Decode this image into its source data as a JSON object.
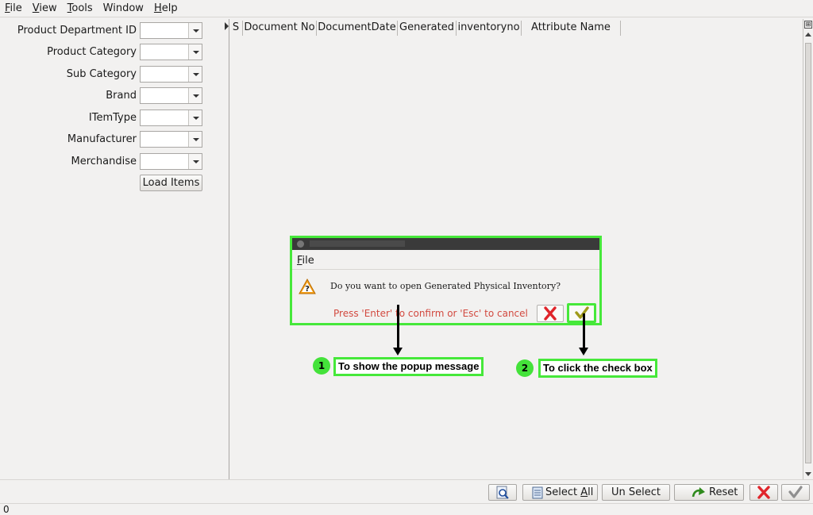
{
  "menu": [
    {
      "label": "File",
      "mnemonic": "F",
      "rest": "ile"
    },
    {
      "label": "View",
      "mnemonic": "V",
      "rest": "iew"
    },
    {
      "label": "Tools",
      "mnemonic": "T",
      "rest": "ools"
    },
    {
      "label": "Window",
      "mnemonic": "",
      "rest": "Window"
    },
    {
      "label": "Help",
      "mnemonic": "H",
      "rest": "elp"
    }
  ],
  "filters": [
    {
      "label": "Product Department ID",
      "value": ""
    },
    {
      "label": "Product Category",
      "value": ""
    },
    {
      "label": "Sub Category",
      "value": ""
    },
    {
      "label": "Brand",
      "value": ""
    },
    {
      "label": "ITemType",
      "value": ""
    },
    {
      "label": "Manufacturer",
      "value": ""
    },
    {
      "label": "Merchandise",
      "value": ""
    }
  ],
  "load_button": "Load Items",
  "table": {
    "columns": [
      "S",
      "Document No",
      "DocumentDate",
      "Generated",
      "inventoryno",
      "Attribute Name"
    ]
  },
  "dialog": {
    "menu_file_mnemonic": "F",
    "menu_file_rest": "ile",
    "message": "Do you want to open Generated Physical Inventory?",
    "hint": "Press 'Enter' to confirm or 'Esc' to cancel"
  },
  "annotations": [
    {
      "number": "1",
      "text": "To show the popup message"
    },
    {
      "number": "2",
      "text": "To click the check box"
    }
  ],
  "toolbar": {
    "select_all_mnemonic": "A",
    "select_all_prefix": "Select ",
    "select_all_suffix": "ll",
    "unselect": "Un Select",
    "reset": "Reset"
  },
  "status": "0",
  "colors": {
    "highlight": "#46e83a",
    "hint_text": "#d2493f",
    "cancel_red": "#e0252b",
    "ok_olive": "#a09a1c"
  }
}
